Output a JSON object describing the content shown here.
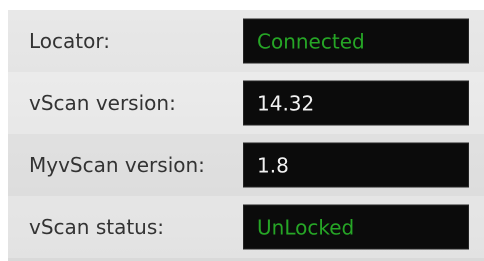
{
  "colors": {
    "panel_bg": "#e0e0e0",
    "value_bg": "#0b0b0b",
    "status_green": "#26a626",
    "value_white": "#f2f2f2",
    "label_text": "#333333"
  },
  "rows": [
    {
      "label": "Locator:",
      "value": "Connected",
      "value_color": "green"
    },
    {
      "label": "vScan version:",
      "value": "14.32",
      "value_color": "white"
    },
    {
      "label": "MyvScan version:",
      "value": "1.8",
      "value_color": "white"
    },
    {
      "label": "vScan status:",
      "value": "UnLocked",
      "value_color": "green"
    }
  ]
}
